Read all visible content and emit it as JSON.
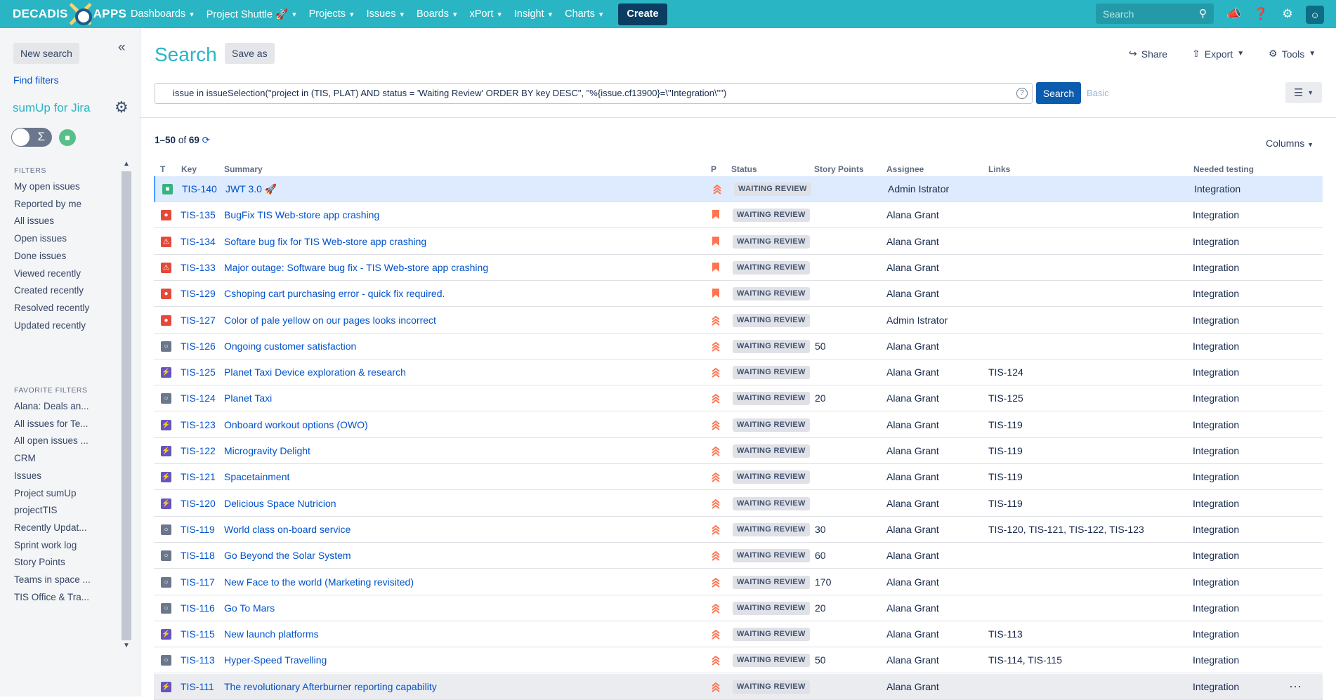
{
  "brand": {
    "left": "DECADIS",
    "right": "APPS"
  },
  "nav": [
    {
      "label": "Dashboards"
    },
    {
      "label": "Project Shuttle 🚀"
    },
    {
      "label": "Projects"
    },
    {
      "label": "Issues"
    },
    {
      "label": "Boards"
    },
    {
      "label": "xPort"
    },
    {
      "label": "Insight"
    },
    {
      "label": "Charts"
    }
  ],
  "create_label": "Create",
  "top_search_placeholder": "Search",
  "sidebar": {
    "new_search": "New search",
    "find_filters": "Find filters",
    "sumup_title": "sumUp for Jira",
    "filters_heading": "FILTERS",
    "filters": [
      "My open issues",
      "Reported by me",
      "All issues",
      "Open issues",
      "Done issues",
      "Viewed recently",
      "Created recently",
      "Resolved recently",
      "Updated recently"
    ],
    "favorite_heading": "FAVORITE FILTERS",
    "favorites": [
      "Alana: Deals an...",
      "All issues for Te...",
      "All open issues ...",
      "CRM",
      "Issues",
      "Project sumUp",
      "projectTIS",
      "Recently Updat...",
      "Sprint work log",
      "Story Points",
      "Teams in space ...",
      "TIS Office & Tra..."
    ]
  },
  "main": {
    "title": "Search",
    "save_as": "Save as",
    "share": "Share",
    "export": "Export",
    "tools": "Tools",
    "jql": "issue in issueSelection(\"project in (TIS, PLAT) AND status = 'Waiting Review' ORDER BY key DESC\", \"%{issue.cf13900}=\\\"Integration\\\"\")",
    "search_button": "Search",
    "basic_link": "Basic",
    "count_range": "1–50",
    "count_of": "of",
    "count_total": "69",
    "columns_button": "Columns"
  },
  "columns": [
    "T",
    "Key",
    "Summary",
    "P",
    "Status",
    "Story Points",
    "Assignee",
    "Links",
    "Needed testing"
  ],
  "colors": {
    "accent": "#2ab5c4",
    "story": "#36b37e",
    "bug": "#e5493a",
    "epic": "#6554c0",
    "task": "#6b778c",
    "priority_high": "#ff7452"
  },
  "issues": [
    {
      "type": "story",
      "key": "TIS-140",
      "summary": "JWT 3.0 🚀",
      "priority": "highest",
      "status": "WAITING REVIEW",
      "sp": "",
      "assignee": "Admin Istrator",
      "links": "",
      "testing": "Integration"
    },
    {
      "type": "bug",
      "key": "TIS-135",
      "summary": "BugFix TIS Web-store app crashing",
      "priority": "blocker",
      "status": "WAITING REVIEW",
      "sp": "",
      "assignee": "Alana Grant",
      "links": "",
      "testing": "Integration"
    },
    {
      "type": "incident",
      "key": "TIS-134",
      "summary": "Softare bug fix for TIS Web-store app crashing",
      "priority": "blocker",
      "status": "WAITING REVIEW",
      "sp": "",
      "assignee": "Alana Grant",
      "links": "",
      "testing": "Integration"
    },
    {
      "type": "incident",
      "key": "TIS-133",
      "summary": "Major outage: Software bug fix - TIS Web-store app crashing",
      "priority": "blocker",
      "status": "WAITING REVIEW",
      "sp": "",
      "assignee": "Alana Grant",
      "links": "",
      "testing": "Integration"
    },
    {
      "type": "bug",
      "key": "TIS-129",
      "summary": "Cshoping cart purchasing error - quick fix required.",
      "priority": "blocker",
      "status": "WAITING REVIEW",
      "sp": "",
      "assignee": "Alana Grant",
      "links": "",
      "testing": "Integration"
    },
    {
      "type": "bug",
      "key": "TIS-127",
      "summary": "Color of pale yellow on our pages looks incorrect",
      "priority": "highest",
      "status": "WAITING REVIEW",
      "sp": "",
      "assignee": "Admin Istrator",
      "links": "",
      "testing": "Integration"
    },
    {
      "type": "task",
      "key": "TIS-126",
      "summary": "Ongoing customer satisfaction",
      "priority": "highest",
      "status": "WAITING REVIEW",
      "sp": "50",
      "assignee": "Alana Grant",
      "links": "",
      "testing": "Integration"
    },
    {
      "type": "epic",
      "key": "TIS-125",
      "summary": "Planet Taxi Device exploration & research",
      "priority": "highest",
      "status": "WAITING REVIEW",
      "sp": "",
      "assignee": "Alana Grant",
      "links": "TIS-124",
      "testing": "Integration"
    },
    {
      "type": "task",
      "key": "TIS-124",
      "summary": "Planet Taxi",
      "priority": "highest",
      "status": "WAITING REVIEW",
      "sp": "20",
      "assignee": "Alana Grant",
      "links": "TIS-125",
      "testing": "Integration"
    },
    {
      "type": "epic",
      "key": "TIS-123",
      "summary": "Onboard workout options (OWO)",
      "priority": "highest",
      "status": "WAITING REVIEW",
      "sp": "",
      "assignee": "Alana Grant",
      "links": "TIS-119",
      "testing": "Integration"
    },
    {
      "type": "epic",
      "key": "TIS-122",
      "summary": "Microgravity Delight",
      "priority": "highest",
      "status": "WAITING REVIEW",
      "sp": "",
      "assignee": "Alana Grant",
      "links": "TIS-119",
      "testing": "Integration"
    },
    {
      "type": "epic",
      "key": "TIS-121",
      "summary": "Spacetainment",
      "priority": "highest",
      "status": "WAITING REVIEW",
      "sp": "",
      "assignee": "Alana Grant",
      "links": "TIS-119",
      "testing": "Integration"
    },
    {
      "type": "epic",
      "key": "TIS-120",
      "summary": "Delicious Space Nutricion",
      "priority": "highest",
      "status": "WAITING REVIEW",
      "sp": "",
      "assignee": "Alana Grant",
      "links": "TIS-119",
      "testing": "Integration"
    },
    {
      "type": "task",
      "key": "TIS-119",
      "summary": "World class on-board service",
      "priority": "highest",
      "status": "WAITING REVIEW",
      "sp": "30",
      "assignee": "Alana Grant",
      "links": "TIS-120, TIS-121, TIS-122, TIS-123",
      "testing": "Integration"
    },
    {
      "type": "task",
      "key": "TIS-118",
      "summary": "Go Beyond the Solar System",
      "priority": "highest",
      "status": "WAITING REVIEW",
      "sp": "60",
      "assignee": "Alana Grant",
      "links": "",
      "testing": "Integration"
    },
    {
      "type": "task",
      "key": "TIS-117",
      "summary": "New Face to the world (Marketing revisited)",
      "priority": "highest",
      "status": "WAITING REVIEW",
      "sp": "170",
      "assignee": "Alana Grant",
      "links": "",
      "testing": "Integration"
    },
    {
      "type": "task",
      "key": "TIS-116",
      "summary": "Go To Mars",
      "priority": "highest",
      "status": "WAITING REVIEW",
      "sp": "20",
      "assignee": "Alana Grant",
      "links": "",
      "testing": "Integration"
    },
    {
      "type": "epic",
      "key": "TIS-115",
      "summary": "New launch platforms",
      "priority": "highest",
      "status": "WAITING REVIEW",
      "sp": "",
      "assignee": "Alana Grant",
      "links": "TIS-113",
      "testing": "Integration"
    },
    {
      "type": "task",
      "key": "TIS-113",
      "summary": "Hyper-Speed Travelling",
      "priority": "highest",
      "status": "WAITING REVIEW",
      "sp": "50",
      "assignee": "Alana Grant",
      "links": "TIS-114, TIS-115",
      "testing": "Integration"
    },
    {
      "type": "epic",
      "key": "TIS-111",
      "summary": "The revolutionary Afterburner reporting capability",
      "priority": "highest",
      "status": "WAITING REVIEW",
      "sp": "",
      "assignee": "Alana Grant",
      "links": "",
      "testing": "Integration"
    }
  ]
}
